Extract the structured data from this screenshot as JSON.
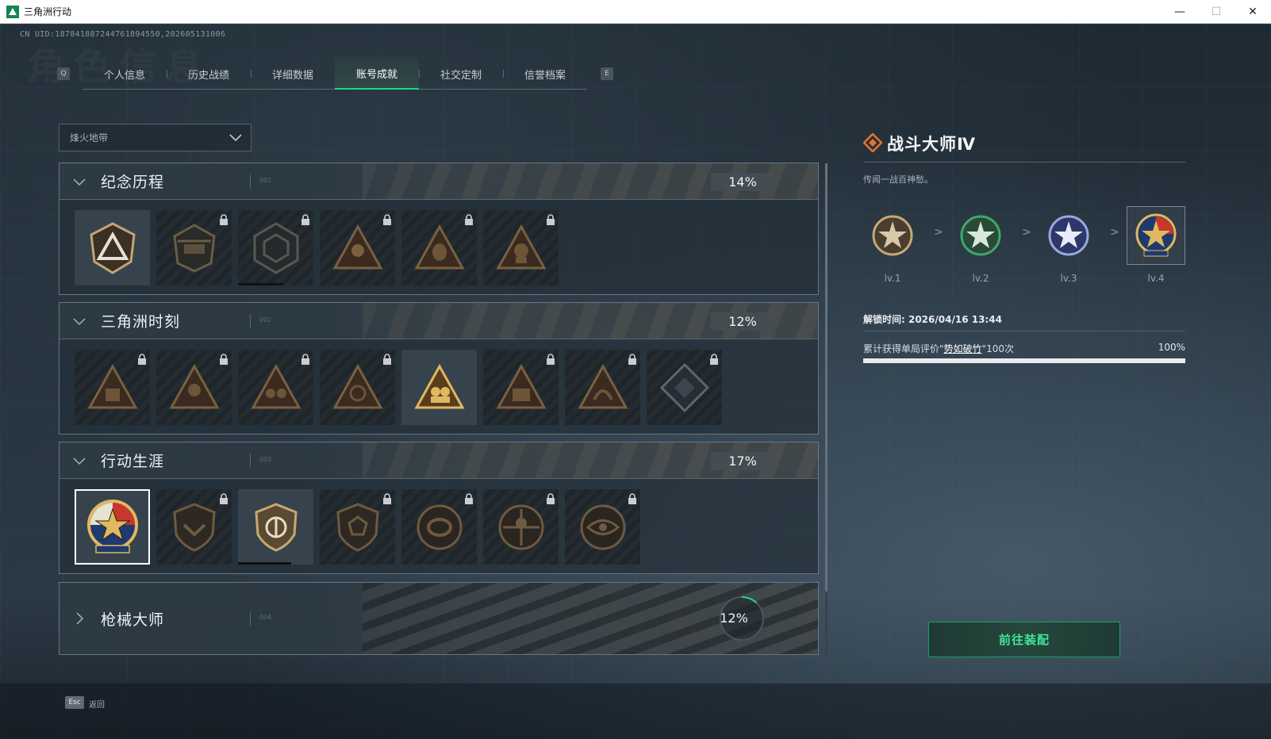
{
  "window": {
    "title": "三角洲行动",
    "minimize": "—",
    "maximize": "☐",
    "close": "✕"
  },
  "uid": "CN UID:18784188724476189455​0,202605131006",
  "watermark": "角色信息",
  "tabs": {
    "prev_key": "Q",
    "next_key": "E",
    "items": [
      {
        "label": "个人信息"
      },
      {
        "label": "历史战绩"
      },
      {
        "label": "详细数据"
      },
      {
        "label": "账号成就",
        "active": true
      },
      {
        "label": "社交定制"
      },
      {
        "label": "信誉档案"
      }
    ]
  },
  "dropdown": {
    "value": "烽火地带"
  },
  "sections": [
    {
      "title": "纪念历程",
      "code": "001",
      "percent": "14%",
      "expanded": true,
      "badges": [
        {
          "icon": "delta-shield-badge",
          "locked": false
        },
        {
          "icon": "helicopter-badge",
          "locked": true
        },
        {
          "icon": "hex-emblem-badge",
          "locked": true,
          "progress": 0.6
        },
        {
          "icon": "warrior-triangle-badge",
          "locked": true
        },
        {
          "icon": "hooded-triangle-badge",
          "locked": true
        },
        {
          "icon": "soldier-triangle-badge",
          "locked": true
        }
      ]
    },
    {
      "title": "三角洲时刻",
      "code": "002",
      "percent": "12%",
      "expanded": true,
      "badges": [
        {
          "icon": "crate-triangle-badge",
          "locked": true
        },
        {
          "icon": "soldier-triangle-badge",
          "locked": true
        },
        {
          "icon": "fighters-triangle-badge",
          "locked": true
        },
        {
          "icon": "hands-triangle-badge",
          "locked": true
        },
        {
          "icon": "team-triangle-badge",
          "locked": false
        },
        {
          "icon": "squad-triangle-badge",
          "locked": true
        },
        {
          "icon": "beast-triangle-badge",
          "locked": true
        },
        {
          "icon": "diamond-cube-badge",
          "locked": true
        }
      ]
    },
    {
      "title": "行动生涯",
      "code": "003",
      "percent": "17%",
      "expanded": true,
      "badges": [
        {
          "icon": "combat-master-star-badge",
          "locked": false,
          "selected": true
        },
        {
          "icon": "chevron-shield-badge",
          "locked": true
        },
        {
          "icon": "wing-shield-badge",
          "locked": false,
          "progress": 0.7
        },
        {
          "icon": "crest-shield-badge",
          "locked": true
        },
        {
          "icon": "ring-medal-badge",
          "locked": true
        },
        {
          "icon": "crosshair-medal-badge",
          "locked": true
        },
        {
          "icon": "eye-medal-badge",
          "locked": true
        }
      ]
    },
    {
      "title": "枪械大师",
      "code": "004",
      "percent": "12%",
      "expanded": false,
      "progress": 0.12
    }
  ],
  "detail": {
    "title": "战斗大师Ⅳ",
    "description": "传闻一战百神愁。",
    "levels": [
      {
        "label": "lv.1",
        "color": "#c8a878"
      },
      {
        "label": "lv.2",
        "color": "#3fa86a"
      },
      {
        "label": "lv.3",
        "color": "#6d7fcf"
      },
      {
        "label": "lv.4",
        "color": "#d94a3a",
        "selected": true
      }
    ],
    "level_arrow": ">",
    "unlock_time": "解锁时间: 2026/04/16 13:44",
    "requirement_prefix": "累计获得单局评价\"",
    "requirement_highlight": "势如破竹",
    "requirement_suffix": "\"100次",
    "requirement_percent": "100%",
    "progress": 1.0,
    "equip_button": "前往装配"
  },
  "footer": {
    "esc_key": "Esc",
    "esc_label": "返回"
  },
  "colors": {
    "accent_green": "#1fd68a",
    "badge_gold": "#b99a66"
  }
}
